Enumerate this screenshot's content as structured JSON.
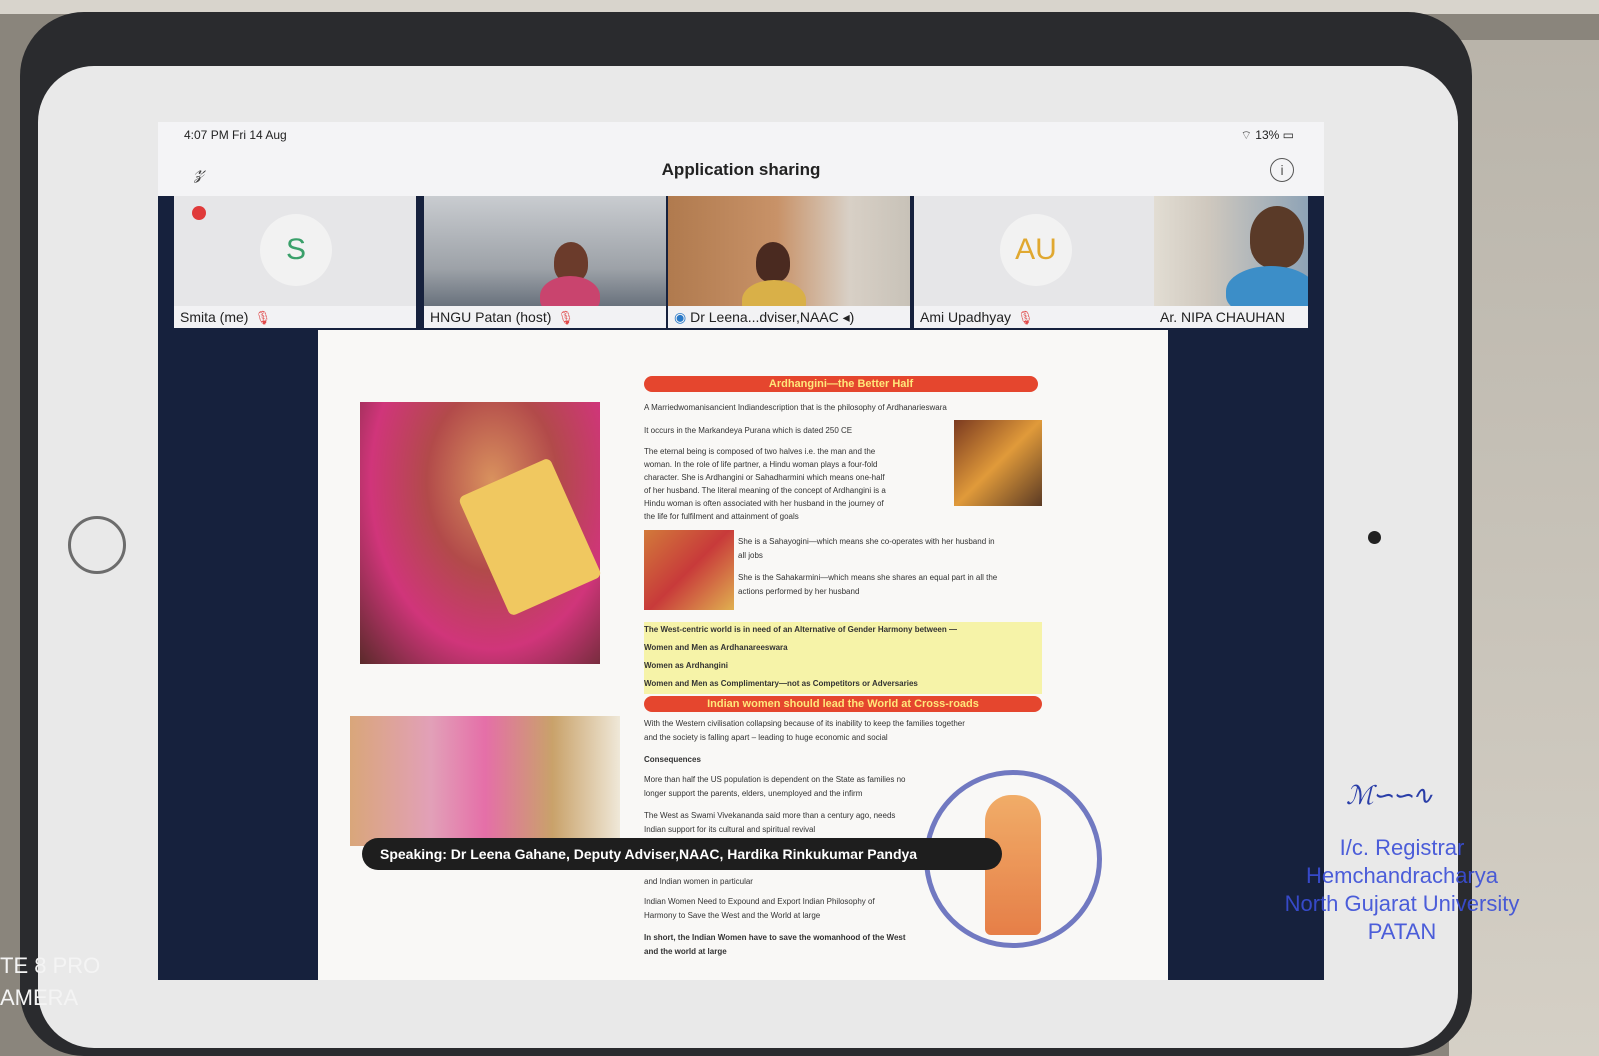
{
  "status_bar": {
    "time": "4:07 PM  Fri 14 Aug",
    "battery": "13%"
  },
  "window": {
    "title": "Application sharing"
  },
  "participants": [
    {
      "name": "Smita (me)",
      "initial": "S",
      "color": "#3aa06a"
    },
    {
      "name": "HNGU Patan (host)"
    },
    {
      "name": "Dr Leena...dviser,NAAC"
    },
    {
      "name": "Ami Upadhyay",
      "initial": "AU",
      "color": "#e0a830"
    },
    {
      "name": "Ar. NIPA CHAUHAN"
    }
  ],
  "document": {
    "heading1": "Ardhangini—the Better Half",
    "heading2": "Indian women should lead the World at Cross-roads",
    "lines_top": [
      "A Marriedwomanisancient Indiandescription that is the philosophy of Ardhanarieswara",
      "It occurs in the Markandeya Purana which is dated 250 CE",
      "The eternal being is composed of two halves i.e. the man and the",
      "woman. In the role of life partner, a Hindu woman plays a four-fold",
      "character. She is Ardhangini or Sahadharmini which means one-half",
      "of her husband. The literal meaning of the concept of Ardhangini is a",
      "Hindu woman is often associated with her husband in the journey of",
      "the life for fulfilment and attainment of goals"
    ],
    "lines_mid": [
      "She is a Sahayogini—which means she co-operates with her husband in",
      "all jobs",
      "She is the Sahakarmini—which means she shares an equal part in all the",
      "actions performed by her husband"
    ],
    "highlight": [
      "The West-centric world is in need of an Alternative of Gender Harmony between —",
      "Women and Men as Ardhanareeswara",
      "Women as Ardhangini",
      "Women and Men as Complimentary—not as Competitors or Adversaries"
    ],
    "lines_bottom": [
      "With the Western civilisation collapsing because of its inability to keep the families together",
      "and the society is falling apart – leading to huge economic and social",
      "Consequences",
      "More than half the US population is dependent on the State as families no",
      "longer support the parents, elders, unemployed and the infirm",
      "The West as Swami Vivekananda said more than a century ago, needs",
      "Indian support for its cultural and spiritual revival"
    ],
    "lines_end": [
      "and Indian women in particular",
      "Indian Women Need to Expound and Export Indian Philosophy of",
      "Harmony to Save the West and the World at large",
      "In short, the Indian Women have to save the womanhood of the West",
      "and the world at large"
    ]
  },
  "speaking": "Speaking: Dr Leena Gahane, Deputy Adviser,NAAC, Hardika Rinkukumar Pandya",
  "stamp": {
    "registrar": [
      "I/c. Registrar",
      "Hemchandracharya",
      "North Gujarat University",
      "PATAN"
    ]
  },
  "watermark": [
    "TE 8 PRO",
    "AMERA"
  ]
}
